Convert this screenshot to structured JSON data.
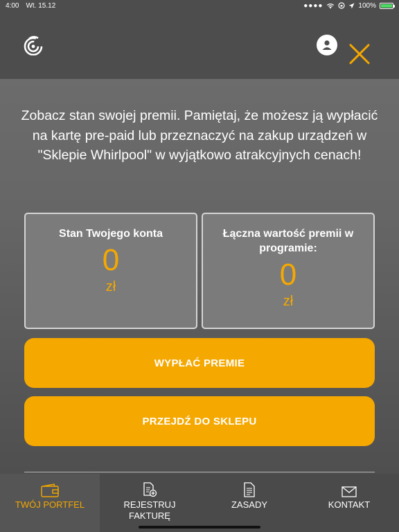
{
  "status_bar": {
    "time": "4:00",
    "date": "Wt. 15.12",
    "battery": "100%"
  },
  "intro_text": "Zobacz stan swojej premii. Pamiętaj, że możesz ją wypłacić na kartę pre-paid lub przeznaczyć na zakup urządzeń w \"Sklepie Whirlpool\" w wyjątkowo atrakcyjnych cenach!",
  "cards": {
    "account": {
      "label": "Stan Twojego konta",
      "value": "0",
      "unit": "zł"
    },
    "total": {
      "label": "Łączna wartość premii w programie:",
      "value": "0",
      "unit": "zł"
    }
  },
  "buttons": {
    "withdraw": "WYPŁAĆ PREMIE",
    "shop": "PRZEJDŹ DO SKLEPU"
  },
  "tabs": [
    {
      "label": "TWÓJ PORTFEL",
      "icon": "wallet-icon",
      "active": true
    },
    {
      "label": "REJESTRUJ FAKTURĘ",
      "icon": "document-add-icon",
      "active": false
    },
    {
      "label": "ZASADY",
      "icon": "document-icon",
      "active": false
    },
    {
      "label": "KONTAKT",
      "icon": "mail-icon",
      "active": false
    }
  ],
  "colors": {
    "accent": "#f5a800",
    "background": "#666666",
    "header": "#4d4d4d",
    "battery": "#4cd964"
  }
}
